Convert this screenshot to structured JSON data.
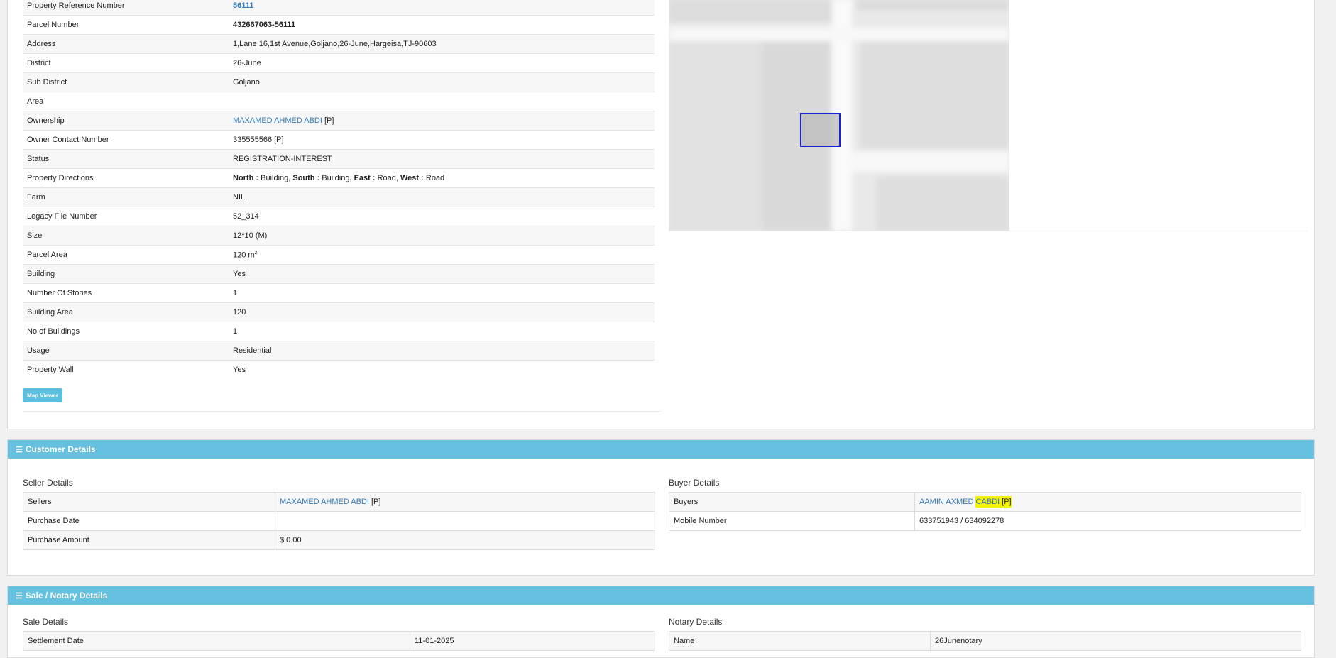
{
  "property": {
    "rows": [
      {
        "label": "Property Reference Number",
        "value": "56111"
      },
      {
        "label": "Parcel Number",
        "value": "432667063-56111"
      },
      {
        "label": "Address",
        "value": "1,Lane 16,1st Avenue,Goljano,26-June,Hargeisa,TJ-90603"
      },
      {
        "label": "District",
        "value": "26-June"
      },
      {
        "label": "Sub District",
        "value": "Goljano"
      },
      {
        "label": "Area",
        "value": ""
      },
      {
        "label": "Ownership",
        "value": "MAXAMED AHMED ABDI",
        "suffix": "[P]"
      },
      {
        "label": "Owner Contact Number",
        "value": "335555566 [P]"
      },
      {
        "label": "Status",
        "value": "REGISTRATION-INTEREST"
      },
      {
        "label": "Property Directions",
        "value": ""
      },
      {
        "label": "Farm",
        "value": "NIL"
      },
      {
        "label": "Legacy File Number",
        "value": "52_314"
      },
      {
        "label": "Size",
        "value": "12*10 (M)"
      },
      {
        "label": "Parcel Area",
        "value": "120 m",
        "sup": "2"
      },
      {
        "label": "Building",
        "value": "Yes"
      },
      {
        "label": "Number Of Stories",
        "value": "1"
      },
      {
        "label": "Building Area",
        "value": "120"
      },
      {
        "label": "No of Buildings",
        "value": "1"
      },
      {
        "label": "Usage",
        "value": "Residential"
      },
      {
        "label": "Property Wall",
        "value": "Yes"
      }
    ],
    "directions": [
      {
        "dir": "North :",
        "val": " Building, "
      },
      {
        "dir": "South :",
        "val": " Building, "
      },
      {
        "dir": "East :",
        "val": " Road, "
      },
      {
        "dir": "West :",
        "val": " Road"
      }
    ],
    "map_button": "Map Viewer"
  },
  "customer": {
    "title": "Customer Details",
    "seller_title": "Seller Details",
    "sellers_label": "Sellers",
    "seller_name": "MAXAMED AHMED ABDI",
    "seller_suffix": "[P]",
    "purchase_date_label": "Purchase Date",
    "purchase_date": "",
    "purchase_amount_label": "Purchase Amount",
    "purchase_amount": "$ 0.00",
    "buyer_title": "Buyer Details",
    "buyers_label": "Buyers",
    "buyer_name_a": "AAMIN AXMED ",
    "buyer_name_b": "CABDI",
    "buyer_suffix": "[P]",
    "mobile_label": "Mobile Number",
    "mobile": "633751943 / 634092278"
  },
  "sale": {
    "title": "Sale / Notary Details",
    "sale_title": "Sale Details",
    "settlement_label": "Settlement Date",
    "settlement_date": "11-01-2025",
    "notary_title": "Notary Details",
    "name_label": "Name",
    "name": "26Junenotary"
  },
  "colors": {
    "header": "#65c1df",
    "link": "#337ab7",
    "highlight": "#f4f40a",
    "parcel_stroke": "#1a22d6"
  }
}
